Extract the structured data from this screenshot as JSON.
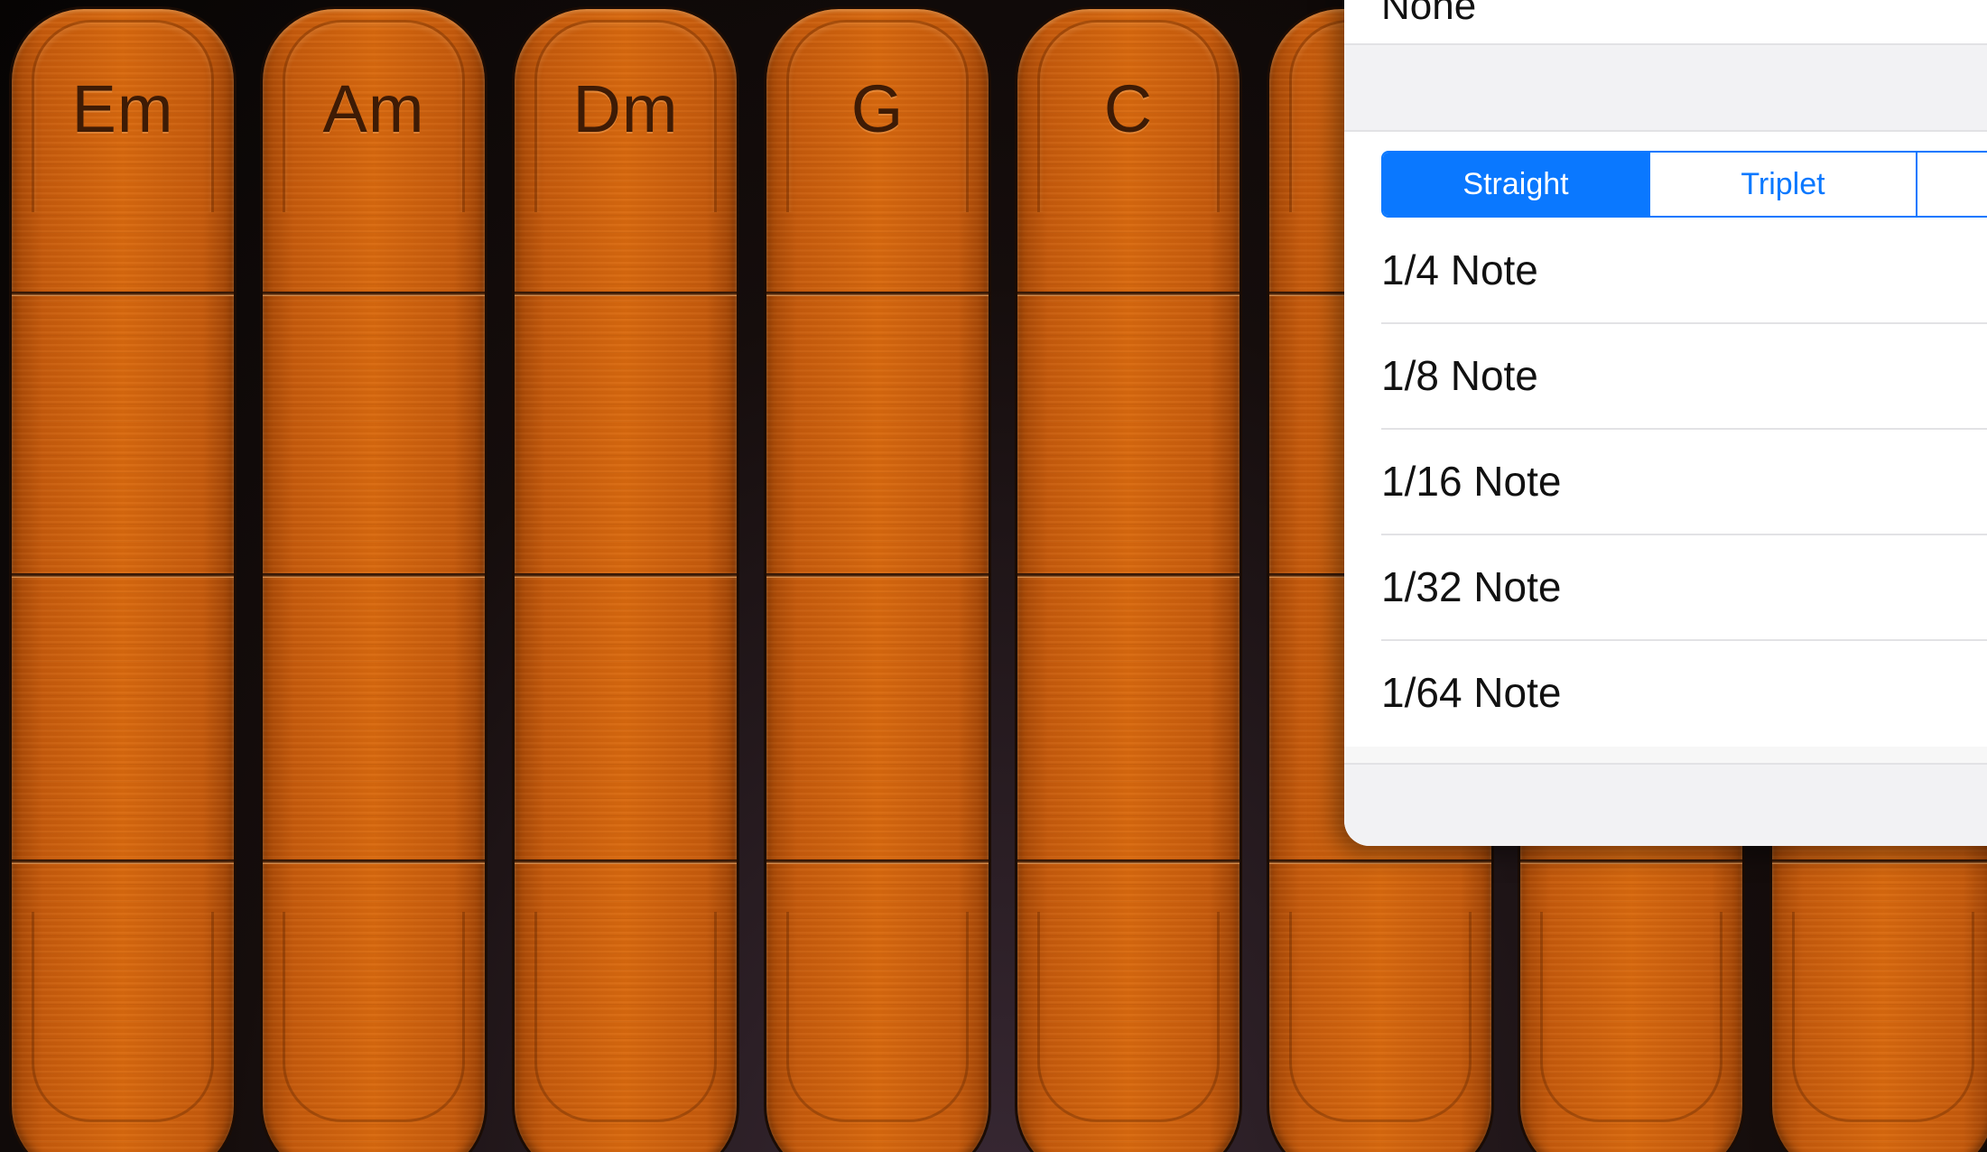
{
  "chord_strips": [
    {
      "label": "Em"
    },
    {
      "label": "Am"
    },
    {
      "label": "Dm"
    },
    {
      "label": "G"
    },
    {
      "label": "C"
    },
    {
      "label": ""
    },
    {
      "label": ""
    },
    {
      "label": ""
    }
  ],
  "popover": {
    "none_option": "None",
    "segments": [
      {
        "label": "Straight",
        "selected": true
      },
      {
        "label": "Triplet",
        "selected": false
      },
      {
        "label": "",
        "selected": false
      }
    ],
    "note_values": [
      "1/4 Note",
      "1/8 Note",
      "1/16 Note",
      "1/32 Note",
      "1/64 Note"
    ]
  },
  "colors": {
    "wood": "#d8690f",
    "chord_text": "#3e1b05",
    "accent": "#0a78ff",
    "popover_bg": "#ffffff"
  }
}
